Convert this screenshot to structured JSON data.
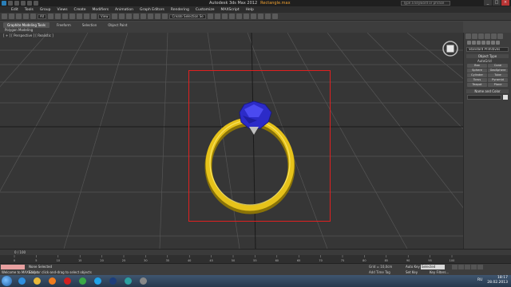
{
  "window": {
    "title": "Autodesk 3ds Max 2012",
    "filename": "Rectangle.max",
    "search_placeholder": "Type a keyword or phrase",
    "controls": [
      "_",
      "□",
      "×"
    ]
  },
  "menubar": {
    "items": [
      "Edit",
      "Tools",
      "Group",
      "Views",
      "Create",
      "Modifiers",
      "Animation",
      "Graph Editors",
      "Rendering",
      "Customize",
      "MAXScript",
      "Help"
    ]
  },
  "toolbar": {
    "selection_set": "All",
    "view_dropdown": "View",
    "named_sel_dropdown": "Create Selection Se"
  },
  "ribbon": {
    "tabs": [
      {
        "label": "Graphite Modeling Tools",
        "active": true
      },
      {
        "label": "Freeform",
        "active": false
      },
      {
        "label": "Selection",
        "active": false
      },
      {
        "label": "Object Paint",
        "active": false
      }
    ],
    "sub_label": "Polygon Modeling"
  },
  "viewport": {
    "label": "[ + ] [ Perspective ] [ Realistic ]",
    "ring_color": "#e6c21a",
    "gem_color": "#2c2bc8",
    "selection_color": "#e02020"
  },
  "command_panel": {
    "category": "Standard Primitives",
    "object_type_title": "Object Type",
    "autogrid_label": "AutoGrid",
    "objects": [
      "Box",
      "Cone",
      "Sphere",
      "GeoSphere",
      "Cylinder",
      "Tube",
      "Torus",
      "Pyramid",
      "Teapot",
      "Plane"
    ],
    "name_color_title": "Name and Color"
  },
  "timeline": {
    "frame_counter": "0 / 100",
    "ticks": [
      "0",
      "5",
      "10",
      "15",
      "20",
      "25",
      "30",
      "35",
      "40",
      "45",
      "50",
      "55",
      "60",
      "65",
      "70",
      "75",
      "80",
      "85",
      "90",
      "95",
      "100"
    ]
  },
  "status": {
    "maxscript_label": "Welcome to MAXScript",
    "line1": "None Selected",
    "line2": "Click or click-and-drag to select objects",
    "grid": "Grid = 10,0cm",
    "add_time_tag": "Add Time Tag",
    "auto_key": "Auto Key",
    "key_mode": "Selected",
    "set_key": "Set Key",
    "key_filters": "Key Filters..."
  },
  "taskbar": {
    "apps": [
      {
        "name": "ie",
        "color": "#2e8fe0"
      },
      {
        "name": "explorer",
        "color": "#e8b83a"
      },
      {
        "name": "media-player",
        "color": "#f07c1e"
      },
      {
        "name": "opera",
        "color": "#d02020"
      },
      {
        "name": "chrome",
        "color": "#3aa845"
      },
      {
        "name": "skype",
        "color": "#1fa3e8"
      },
      {
        "name": "photoshop",
        "color": "#1d3d7a"
      },
      {
        "name": "3dsmax",
        "color": "#2ca0a0"
      },
      {
        "name": "app-9",
        "color": "#888888"
      }
    ],
    "language": "RU",
    "time": "18:17",
    "date": "28.02.2013"
  }
}
